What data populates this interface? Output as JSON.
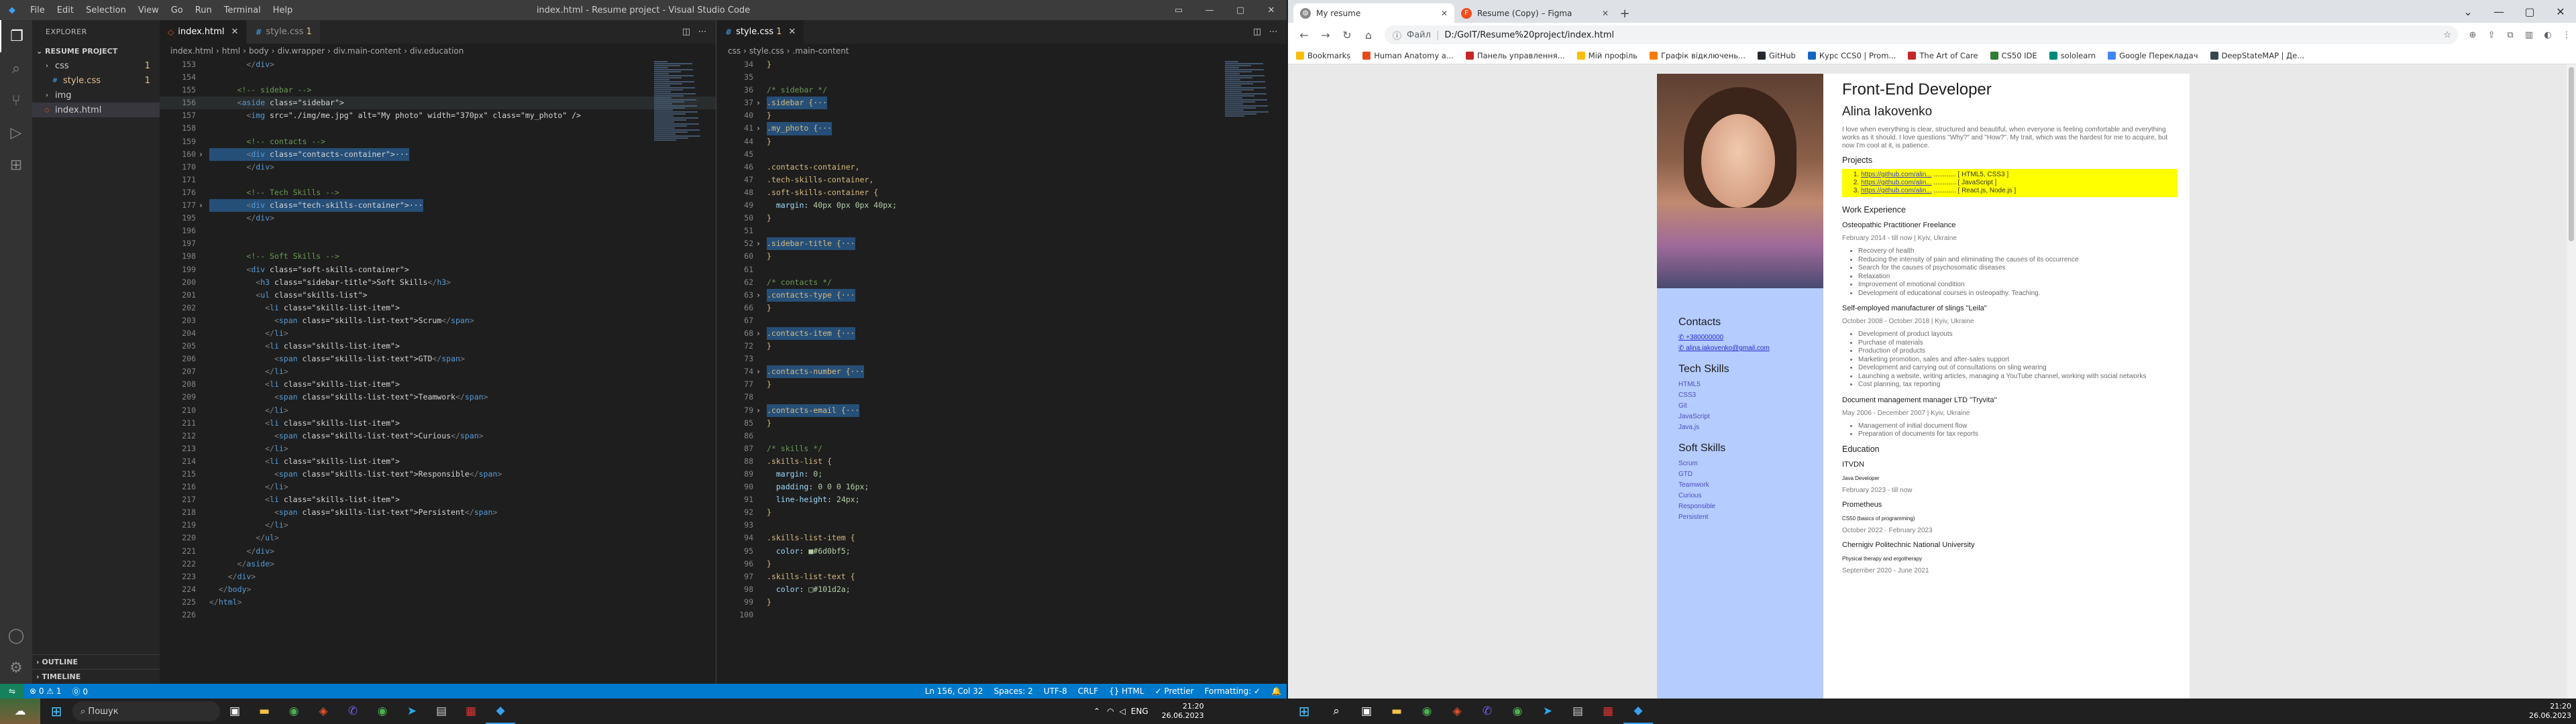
{
  "vscode": {
    "title": "index.html - Resume project - Visual Studio Code",
    "menu": [
      "File",
      "Edit",
      "Selection",
      "View",
      "Go",
      "Run",
      "Terminal",
      "Help"
    ],
    "explorer": {
      "header": "EXPLORER",
      "project": "RESUME PROJECT",
      "items": [
        {
          "name": "css",
          "type": "folder",
          "badge": "1"
        },
        {
          "name": "style.css",
          "type": "css",
          "badge": "1"
        },
        {
          "name": "img",
          "type": "folder",
          "badge": ""
        },
        {
          "name": "index.html",
          "type": "html",
          "badge": ""
        }
      ],
      "outline": "OUTLINE",
      "timeline": "TIMELINE"
    },
    "left_tabs": [
      {
        "name": "index.html",
        "active": true
      },
      {
        "name": "style.css",
        "active": false,
        "mod": "1"
      }
    ],
    "left_breadcrumb": [
      "index.html",
      "html",
      "body",
      "div.wrapper",
      "div.main-content",
      "div.education"
    ],
    "right_tabs": [
      {
        "name": "style.css",
        "active": true,
        "mod": "1"
      }
    ],
    "right_breadcrumb": [
      "css",
      "style.css",
      ".main-content"
    ],
    "html_lines": [
      {
        "n": "153",
        "t": "        </div>"
      },
      {
        "n": "154",
        "t": ""
      },
      {
        "n": "155",
        "t": "      <!-- sidebar -->"
      },
      {
        "n": "156",
        "t": "      <aside class=\"sidebar\">"
      },
      {
        "n": "157",
        "t": "        <img src=\"./img/me.jpg\" alt=\"My photo\" width=\"370px\" class=\"my_photo\" />"
      },
      {
        "n": "158",
        "t": ""
      },
      {
        "n": "159",
        "t": "        <!-- contacts -->"
      },
      {
        "n": "160",
        "t": "        <div class=\"contacts-container\">···",
        "fold": true
      },
      {
        "n": "170",
        "t": "        </div>"
      },
      {
        "n": "171",
        "t": ""
      },
      {
        "n": "176",
        "t": "        <!-- Tech Skills -->"
      },
      {
        "n": "177",
        "t": "        <div class=\"tech-skills-container\">···",
        "fold": true
      },
      {
        "n": "195",
        "t": "        </div>"
      },
      {
        "n": "196",
        "t": ""
      },
      {
        "n": "197",
        "t": ""
      },
      {
        "n": "198",
        "t": "        <!-- Soft Skills -->"
      },
      {
        "n": "199",
        "t": "        <div class=\"soft-skills-container\">"
      },
      {
        "n": "200",
        "t": "          <h3 class=\"sidebar-title\">Soft Skills</h3>"
      },
      {
        "n": "201",
        "t": "          <ul class=\"skills-list\">"
      },
      {
        "n": "202",
        "t": "            <li class=\"skills-list-item\">"
      },
      {
        "n": "203",
        "t": "              <span class=\"skills-list-text\">Scrum</span>"
      },
      {
        "n": "204",
        "t": "            </li>"
      },
      {
        "n": "205",
        "t": "            <li class=\"skills-list-item\">"
      },
      {
        "n": "206",
        "t": "              <span class=\"skills-list-text\">GTD</span>"
      },
      {
        "n": "207",
        "t": "            </li>"
      },
      {
        "n": "208",
        "t": "            <li class=\"skills-list-item\">"
      },
      {
        "n": "209",
        "t": "              <span class=\"skills-list-text\">Teamwork</span>"
      },
      {
        "n": "210",
        "t": "            </li>"
      },
      {
        "n": "211",
        "t": "            <li class=\"skills-list-item\">"
      },
      {
        "n": "212",
        "t": "              <span class=\"skills-list-text\">Curious</span>"
      },
      {
        "n": "213",
        "t": "            </li>"
      },
      {
        "n": "214",
        "t": "            <li class=\"skills-list-item\">"
      },
      {
        "n": "215",
        "t": "              <span class=\"skills-list-text\">Responsible</span>"
      },
      {
        "n": "216",
        "t": "            </li>"
      },
      {
        "n": "217",
        "t": "            <li class=\"skills-list-item\">"
      },
      {
        "n": "218",
        "t": "              <span class=\"skills-list-text\">Persistent</span>"
      },
      {
        "n": "219",
        "t": "            </li>"
      },
      {
        "n": "220",
        "t": "          </ul>"
      },
      {
        "n": "221",
        "t": "        </div>"
      },
      {
        "n": "222",
        "t": "      </aside>"
      },
      {
        "n": "223",
        "t": "    </div>"
      },
      {
        "n": "224",
        "t": "  </body>"
      },
      {
        "n": "225",
        "t": "</html>"
      },
      {
        "n": "226",
        "t": ""
      }
    ],
    "css_lines": [
      {
        "n": "34",
        "t": "}"
      },
      {
        "n": "35",
        "t": ""
      },
      {
        "n": "36",
        "t": "/* sidebar */"
      },
      {
        "n": "37",
        "t": ".sidebar {···",
        "fold": true
      },
      {
        "n": "40",
        "t": "}"
      },
      {
        "n": "41",
        "t": ".my_photo {···",
        "fold": true
      },
      {
        "n": "44",
        "t": "}"
      },
      {
        "n": "45",
        "t": ""
      },
      {
        "n": "46",
        "t": ".contacts-container,"
      },
      {
        "n": "47",
        "t": ".tech-skills-container,"
      },
      {
        "n": "48",
        "t": ".soft-skills-container {"
      },
      {
        "n": "49",
        "t": "  margin: 40px 0px 0px 40px;"
      },
      {
        "n": "50",
        "t": "}"
      },
      {
        "n": "51",
        "t": ""
      },
      {
        "n": "52",
        "t": ".sidebar-title {···",
        "fold": true
      },
      {
        "n": "60",
        "t": "}"
      },
      {
        "n": "61",
        "t": ""
      },
      {
        "n": "62",
        "t": "/* contacts */"
      },
      {
        "n": "63",
        "t": ".contacts-type {···",
        "fold": true
      },
      {
        "n": "66",
        "t": "}"
      },
      {
        "n": "67",
        "t": ""
      },
      {
        "n": "68",
        "t": ".contacts-item {···",
        "fold": true
      },
      {
        "n": "72",
        "t": "}"
      },
      {
        "n": "73",
        "t": ""
      },
      {
        "n": "74",
        "t": ".contacts-number {···",
        "fold": true
      },
      {
        "n": "77",
        "t": "}"
      },
      {
        "n": "78",
        "t": ""
      },
      {
        "n": "79",
        "t": ".contacts-email {···",
        "fold": true
      },
      {
        "n": "85",
        "t": "}"
      },
      {
        "n": "86",
        "t": ""
      },
      {
        "n": "87",
        "t": "/* skills */"
      },
      {
        "n": "88",
        "t": ".skills-list {"
      },
      {
        "n": "89",
        "t": "  margin: 0;"
      },
      {
        "n": "90",
        "t": "  padding: 0 0 0 16px;"
      },
      {
        "n": "91",
        "t": "  line-height: 24px;"
      },
      {
        "n": "92",
        "t": "}"
      },
      {
        "n": "93",
        "t": ""
      },
      {
        "n": "94",
        "t": ".skills-list-item {"
      },
      {
        "n": "95",
        "t": "  color: ■#6d0bf5;"
      },
      {
        "n": "96",
        "t": "}"
      },
      {
        "n": "97",
        "t": ".skills-list-text {"
      },
      {
        "n": "98",
        "t": "  color: □#101d2a;"
      },
      {
        "n": "99",
        "t": "}"
      },
      {
        "n": "100",
        "t": ""
      }
    ],
    "status": {
      "left": [
        "⊗ 0 ⚠ 1",
        "⓪ 0"
      ],
      "right": [
        "Ln 156, Col 32",
        "Spaces: 2",
        "UTF-8",
        "CRLF",
        "{} HTML",
        "✓ Prettier",
        "Formatting: ✓",
        "🔔"
      ]
    }
  },
  "chrome": {
    "tabs": [
      {
        "title": "My resume",
        "active": true
      },
      {
        "title": "Resume (Copy) – Figma",
        "active": false
      }
    ],
    "url_label": "Файл",
    "url": "D:/GoIT/Resume%20project/index.html",
    "bookmarks": [
      "Bookmarks",
      "Human Anatomy a...",
      "Панель управлення...",
      "Мій профіль",
      "Графік відключень...",
      "GitHub",
      "Курс ССS0 | Prom...",
      "The Art of Care",
      "CS50 IDE",
      "sololearn",
      "Google Перекладач",
      "DeepStateMAP | Де..."
    ]
  },
  "resume": {
    "title": "Front-End Developer",
    "name": "Alina Iakovenko",
    "intro": "I love when everything is clear, structured and beautiful, when everyone is feeling comfortable and everything works as it should. I love questions \"Why?\" and \"How?\". My trait, which was the hardest for me to acquire, but now I'm cool at it, is patience.",
    "projects_title": "Projects",
    "projects": [
      {
        "link": "https://github.com/alin...",
        "tech": "[ HTML5, CSS3 ]"
      },
      {
        "link": "https://github.com/alin...",
        "tech": "[ JavaScript ]"
      },
      {
        "link": "https://github.com/alin...",
        "tech": "[ React.js, Node.js ]"
      }
    ],
    "work_title": "Work Experience",
    "jobs": [
      {
        "title": "Osteopathic Practitioner Freelance",
        "date": "February 2014 - till now | Kyiv, Ukraine",
        "items": [
          "Recovery of health",
          "Reducing the intensity of pain and eliminating the causes of its occurrence",
          "Search for the causes of psychosomatic diseases",
          "Relaxation",
          "Improvement of emotional condition",
          "Development of educational courses in osteopathy. Teaching."
        ]
      },
      {
        "title": "Self-employed manufacturer of slings \"Leila\"",
        "date": "October 2008 - October 2018 | Kyiv, Ukraine",
        "items": [
          "Development of product layouts",
          "Purchase of materials",
          "Production of products",
          "Marketing promotion, sales and after-sales support",
          "Development and carrying out of consultations on sling wearing",
          "Launching a website, writing articles, managing a YouTube channel, working with social networks",
          "Cost planning, tax reporting"
        ]
      },
      {
        "title": "Document management manager LTD \"Tryvita\"",
        "date": "May 2006 - December 2007 | Kyiv, Ukraine",
        "items": [
          "Management of initial document flow",
          "Preparation of documents for tax reports"
        ]
      }
    ],
    "edu_title": "Education",
    "edu": [
      {
        "school": "ITVDN",
        "course": "Java Developer",
        "date": "February 2023 - till now"
      },
      {
        "school": "Prometheus",
        "course": "CS50 (basics of programming)",
        "date": "October 2022 - February 2023"
      },
      {
        "school": "Chernigiv Politechnic National University",
        "course": "Physical therapy and ergotherapy",
        "date": "September 2020 - June 2021"
      }
    ],
    "contacts_title": "Contacts",
    "contacts": [
      "+380000000",
      "alina.iakovenko@gmail.com"
    ],
    "tech_title": "Tech Skills",
    "tech": [
      "HTML5",
      "CSS3",
      "Git",
      "JavaScript",
      "Java.js"
    ],
    "soft_title": "Soft Skills",
    "soft": [
      "Scrum",
      "GTD",
      "Teamwork",
      "Curious",
      "Responsible",
      "Persistent"
    ]
  },
  "taskbar": {
    "search": "Пошук",
    "lang": "ENG",
    "time": "21:20",
    "date": "26.06.2023"
  }
}
